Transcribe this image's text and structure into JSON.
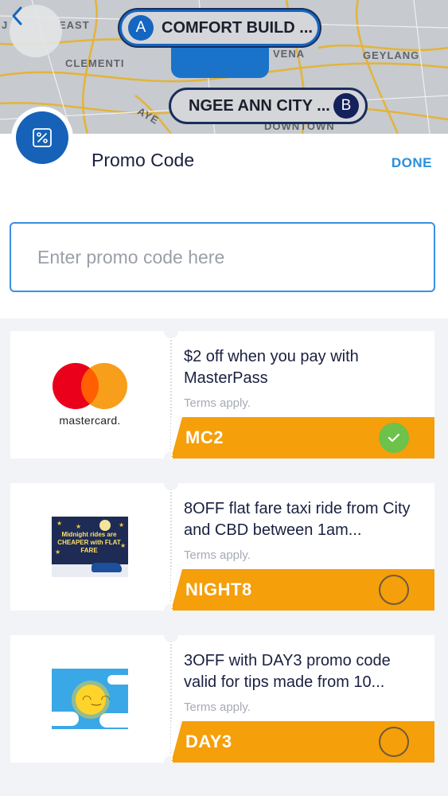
{
  "map": {
    "labels": {
      "west_fragment": "J",
      "east_fragment": "EAST",
      "clementi": "CLEMENTI",
      "vena": "VENA",
      "geylang": "GEYLANG",
      "aye": "AYE",
      "downtown": "DOWNTOWN"
    },
    "pickup": {
      "badge": "A",
      "label": "COMFORT BUILD ..."
    },
    "dropoff": {
      "badge": "B",
      "label": "NGEE ANN CITY ..."
    }
  },
  "header": {
    "title": "Promo Code",
    "done_label": "DONE"
  },
  "search": {
    "placeholder": "Enter promo code here",
    "value": ""
  },
  "promos": [
    {
      "description": "$2 off when you pay with MasterPass",
      "terms": "Terms apply.",
      "code": "MC2",
      "selected": true,
      "image": {
        "type": "mastercard-logo",
        "wordmark": "mastercard."
      }
    },
    {
      "description": "8OFF flat fare taxi ride from City and CBD between 1am...",
      "terms": "Terms apply.",
      "code": "NIGHT8",
      "selected": false,
      "image": {
        "type": "night-illustration",
        "text": "Midnight rides are CHEAPER with FLAT FARE"
      }
    },
    {
      "description": "3OFF with DAY3 promo code valid for tips made from 10...",
      "terms": "Terms apply.",
      "code": "DAY3",
      "selected": false,
      "image": {
        "type": "sun-illustration"
      }
    }
  ],
  "colors": {
    "brand_blue": "#1562b8",
    "accent_link": "#2a8fdc",
    "code_bar": "#f59f0a",
    "check_green": "#6cc24a"
  }
}
